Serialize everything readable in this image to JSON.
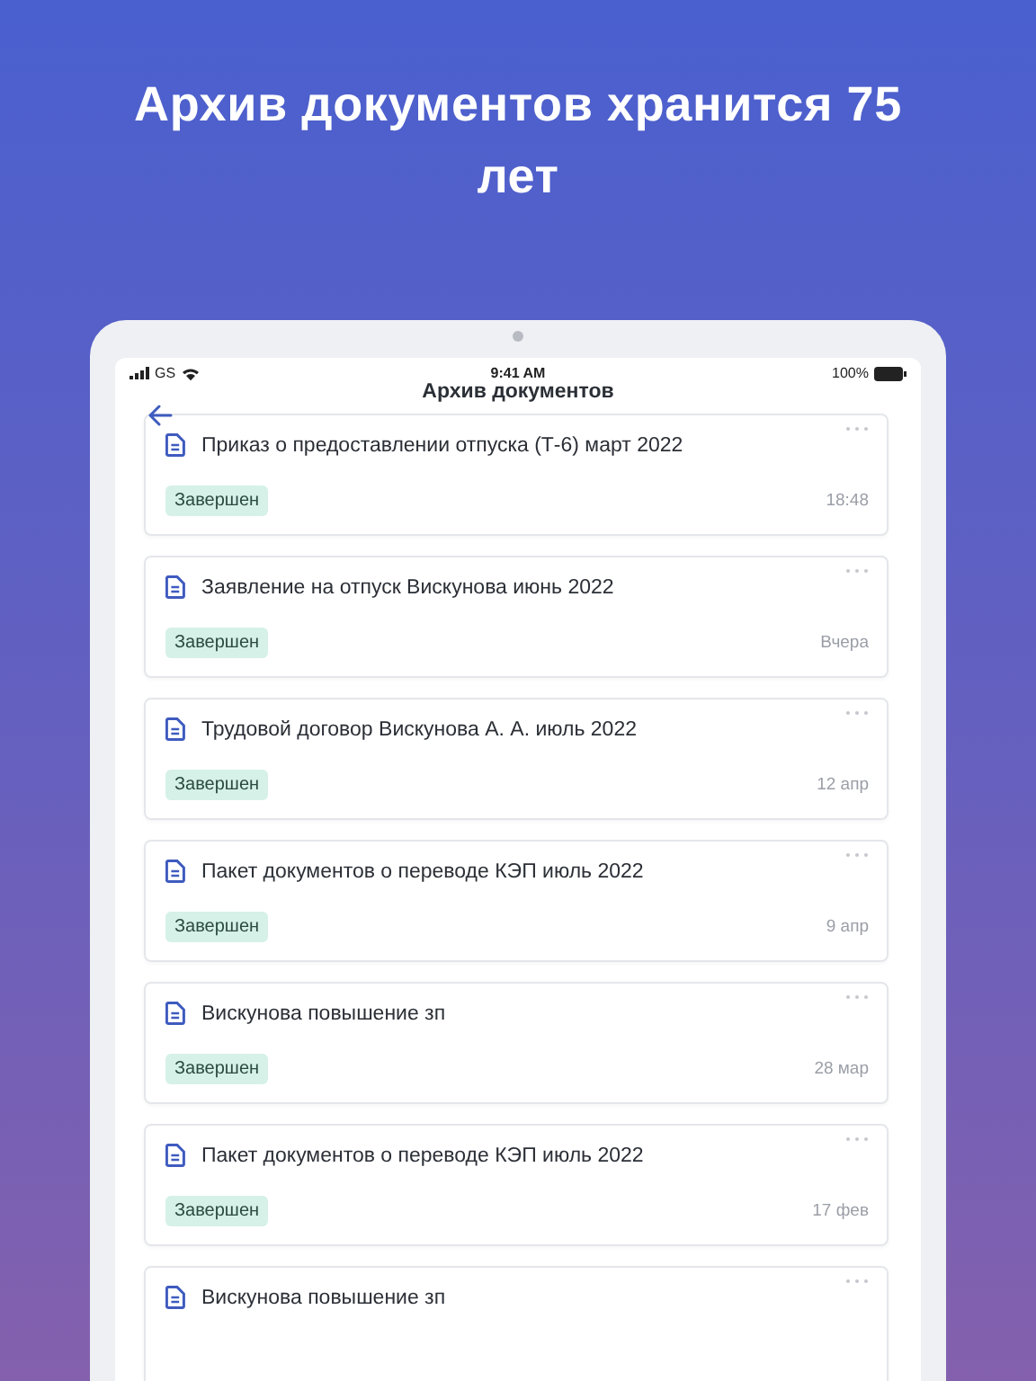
{
  "headline": "Архив документов хранится 75 лет",
  "status_bar": {
    "carrier": "GS",
    "time": "9:41 AM",
    "battery": "100%"
  },
  "nav": {
    "title": "Архив документов"
  },
  "documents": [
    {
      "title": "Приказ о предоставлении отпуска (Т-6) март 2022",
      "status": "Завершен",
      "date": "18:48"
    },
    {
      "title": "Заявление на отпуск Вискунова июнь 2022",
      "status": "Завершен",
      "date": "Вчера"
    },
    {
      "title": "Трудовой договор Вискунова А. А. июль 2022",
      "status": "Завершен",
      "date": "12 апр"
    },
    {
      "title": "Пакет документов о переводе КЭП июль 2022",
      "status": "Завершен",
      "date": "9 апр"
    },
    {
      "title": "Вискунова повышение зп",
      "status": "Завершен",
      "date": "28 мар"
    },
    {
      "title": "Пакет документов о переводе КЭП июль 2022",
      "status": "Завершен",
      "date": "17 фев"
    },
    {
      "title": "Вискунова повышение зп"
    }
  ]
}
